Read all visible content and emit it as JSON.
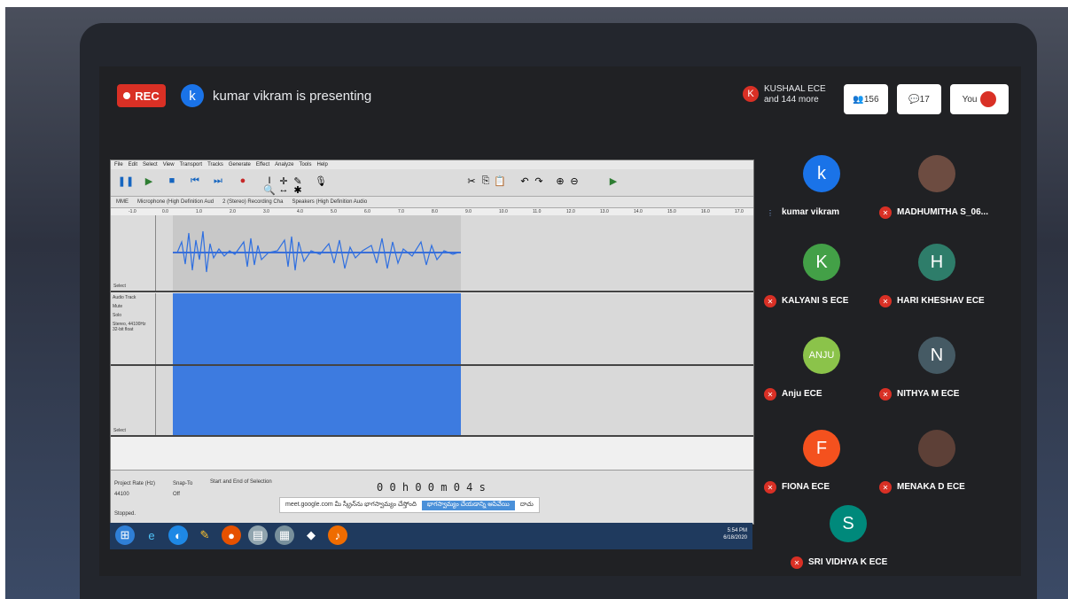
{
  "meet": {
    "rec_label": "REC",
    "presenter_initial": "k",
    "presenter_text": "kumar vikram is presenting",
    "other_initial": "K",
    "other_line1": "KUSHAAL ECE",
    "other_line2": "and 144 more",
    "people_count": "156",
    "chat_count": "17",
    "you_label": "You"
  },
  "participants": [
    {
      "name": "kumar vikram",
      "initial": "k",
      "color": "#1a73e8",
      "mic": "active"
    },
    {
      "name": "MADHUMITHA S_06...",
      "initial": "",
      "color": "#6d4c41",
      "mic": "muted"
    },
    {
      "name": "KALYANI S ECE",
      "initial": "K",
      "color": "#43a047",
      "mic": "muted"
    },
    {
      "name": "HARI KHESHAV ECE",
      "initial": "H",
      "color": "#2e7d6a",
      "mic": "muted"
    },
    {
      "name": "Anju ECE",
      "initial": "ANJU",
      "color": "#8bc34a",
      "mic": "muted"
    },
    {
      "name": "NITHYA M ECE",
      "initial": "N",
      "color": "#455a64",
      "mic": "muted"
    },
    {
      "name": "FIONA ECE",
      "initial": "F",
      "color": "#f4511e",
      "mic": "muted"
    },
    {
      "name": "MENAKA D ECE",
      "initial": "",
      "color": "#5d4037",
      "mic": "muted"
    },
    {
      "name": "SRI VIDHYA K ECE",
      "initial": "S",
      "color": "#00897b",
      "mic": "muted"
    }
  ],
  "audacity": {
    "menus": [
      "File",
      "Edit",
      "Select",
      "View",
      "Transport",
      "Tracks",
      "Generate",
      "Effect",
      "Analyze",
      "Tools",
      "Help"
    ],
    "mic_device": "Microphone (High Definition Aud",
    "channels": "2 (Stereo) Recording Cha",
    "speaker_device": "Speakers (High Definition Audio",
    "host": "MME",
    "ruler_ticks": [
      "-1.0",
      "0.0",
      "1.0",
      "2.0",
      "3.0",
      "4.0",
      "5.0",
      "6.0",
      "7.0",
      "8.0",
      "9.0",
      "10.0",
      "11.0",
      "12.0",
      "13.0",
      "14.0",
      "15.0",
      "16.0",
      "17.0"
    ],
    "track_name": "Audio Track",
    "track_info": "Stereo, 44100Hz 32-bit float",
    "select_label": "Select",
    "mute_label": "Mute",
    "solo_label": "Solo",
    "project_rate_label": "Project Rate (Hz)",
    "project_rate": "44100",
    "snap_label": "Snap-To",
    "snap_value": "Off",
    "selection_label": "Start and End of Selection",
    "stopped": "Stopped.",
    "time_display": "0 0 h 0 0 m 0 4 s"
  },
  "notification": {
    "text": "meet.google.com మీ స్క్రీన్‌ను భాగస్వామ్యం చేస్తోంది",
    "stop_button": "భాగస్వామ్యం చేయడాన్ని ఆపివేయి",
    "hide_button": "దాచు"
  },
  "taskbar": {
    "time": "5:54 PM",
    "date": "6/18/2020"
  }
}
